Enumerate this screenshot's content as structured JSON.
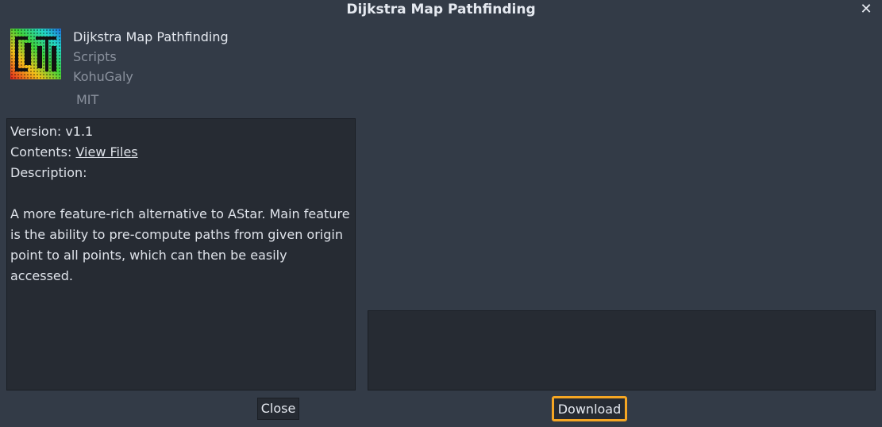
{
  "dialog": {
    "title": "Dijkstra Map Pathfinding",
    "close_glyph": "✕"
  },
  "asset": {
    "icon": "dijkstra-map-icon",
    "name": "Dijkstra Map Pathfinding",
    "category": "Scripts",
    "author": "KohuGaly",
    "license": "MIT"
  },
  "details": {
    "version_label": "Version: v1.1",
    "contents_prefix": "Contents: ",
    "contents_link": "View Files",
    "description_label": "Description:",
    "description_text": "A more feature-rich alternative to AStar. Main feature is the ability to pre-compute paths from given origin point to all points, which can then be easily accessed."
  },
  "buttons": {
    "close_label": "Close",
    "download_label": "Download"
  },
  "colors": {
    "background": "#333b47",
    "panel": "#262b33",
    "accent": "#f5a623"
  }
}
